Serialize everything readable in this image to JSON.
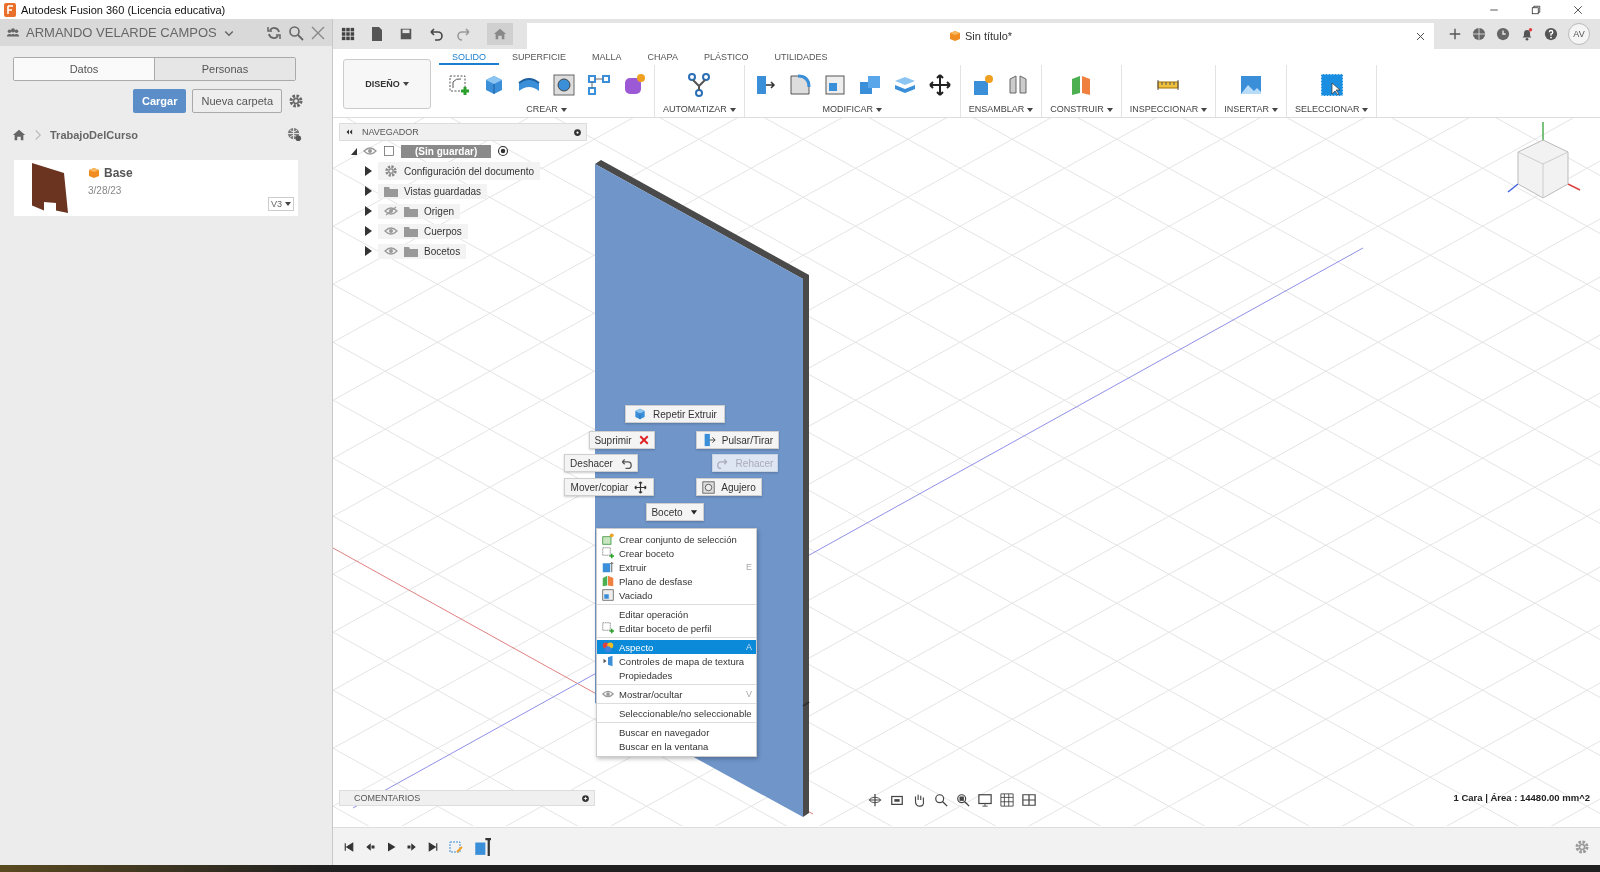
{
  "window": {
    "title": "Autodesk Fusion 360 (Licencia educativa)"
  },
  "data_panel": {
    "user": "ARMANDO VELARDE CAMPOS",
    "tabs": [
      {
        "label": "Datos",
        "selected": true
      },
      {
        "label": "Personas",
        "selected": false
      }
    ],
    "upload_button": "Cargar",
    "new_folder_button": "Nueva carpeta",
    "breadcrumb": "TrabajoDelCurso",
    "files": [
      {
        "name": "Base",
        "date": "3/28/23",
        "version": "V3"
      }
    ]
  },
  "document_tab": {
    "title": "Sin título*"
  },
  "user_avatar": "AV",
  "workspace": "DISEÑO",
  "ribbon_tabs": [
    {
      "label": "SOLIDO",
      "selected": true
    },
    {
      "label": "SUPERFICIE",
      "selected": false
    },
    {
      "label": "MALLA",
      "selected": false
    },
    {
      "label": "CHAPA",
      "selected": false
    },
    {
      "label": "PLÁSTICO",
      "selected": false
    },
    {
      "label": "UTILIDADES",
      "selected": false
    }
  ],
  "ribbon_groups": [
    {
      "label": "CREAR"
    },
    {
      "label": "AUTOMATIZAR"
    },
    {
      "label": "MODIFICAR"
    },
    {
      "label": "ENSAMBLAR"
    },
    {
      "label": "CONSTRUIR"
    },
    {
      "label": "INSPECCIONAR"
    },
    {
      "label": "INSERTAR"
    },
    {
      "label": "SELECCIONAR"
    }
  ],
  "navigator": {
    "title": "NAVEGADOR",
    "root": {
      "label": "(Sin guardar)",
      "selected": true,
      "expanded": true,
      "children": [
        {
          "label": "Configuración del documento",
          "kind": "settings",
          "expanded": false,
          "selected": false
        },
        {
          "label": "Vistas guardadas",
          "kind": "folder",
          "expanded": false,
          "selected": false
        },
        {
          "label": "Origen",
          "kind": "toggle-folder",
          "visible": false,
          "expanded": false,
          "selected": false
        },
        {
          "label": "Cuerpos",
          "kind": "toggle-folder",
          "visible": true,
          "expanded": false,
          "selected": false
        },
        {
          "label": "Bocetos",
          "kind": "toggle-folder",
          "visible": true,
          "expanded": false,
          "selected": false
        }
      ]
    }
  },
  "marking_menu": [
    {
      "label": "Repetir Extruir",
      "disabled": false
    },
    {
      "label": "Suprimir",
      "disabled": false
    },
    {
      "label": "Pulsar/Tirar",
      "disabled": false
    },
    {
      "label": "Deshacer",
      "disabled": false
    },
    {
      "label": "Rehacer",
      "disabled": true
    },
    {
      "label": "Mover/copiar",
      "disabled": false
    },
    {
      "label": "Agujero",
      "disabled": false
    },
    {
      "label": "Boceto",
      "disabled": false
    }
  ],
  "context_menu": {
    "sections": [
      {
        "items": [
          {
            "label": "Crear conjunto de selección",
            "selected": false
          },
          {
            "label": "Crear boceto",
            "selected": false
          },
          {
            "label": "Extruir",
            "shortcut": "E",
            "selected": false
          },
          {
            "label": "Plano de desfase",
            "selected": false
          },
          {
            "label": "Vaciado",
            "selected": false
          }
        ]
      },
      {
        "items": [
          {
            "label": "Editar operación",
            "selected": false
          },
          {
            "label": "Editar boceto de perfil",
            "selected": false
          }
        ]
      },
      {
        "items": [
          {
            "label": "Aspecto",
            "shortcut": "A",
            "selected": true
          },
          {
            "label": "Controles de mapa de textura",
            "selected": false
          },
          {
            "label": "Propiedades",
            "selected": false
          }
        ]
      },
      {
        "items": [
          {
            "label": "Mostrar/ocultar",
            "shortcut": "V",
            "selected": false
          }
        ]
      },
      {
        "items": [
          {
            "label": "Seleccionable/no seleccionable",
            "selected": false
          }
        ]
      },
      {
        "items": [
          {
            "label": "Buscar en navegador",
            "selected": false
          },
          {
            "label": "Buscar en la ventana",
            "selected": false
          }
        ]
      }
    ]
  },
  "comments": {
    "title": "COMENTARIOS"
  },
  "status": "1 Cara | Área : 14480.00 mm^2"
}
